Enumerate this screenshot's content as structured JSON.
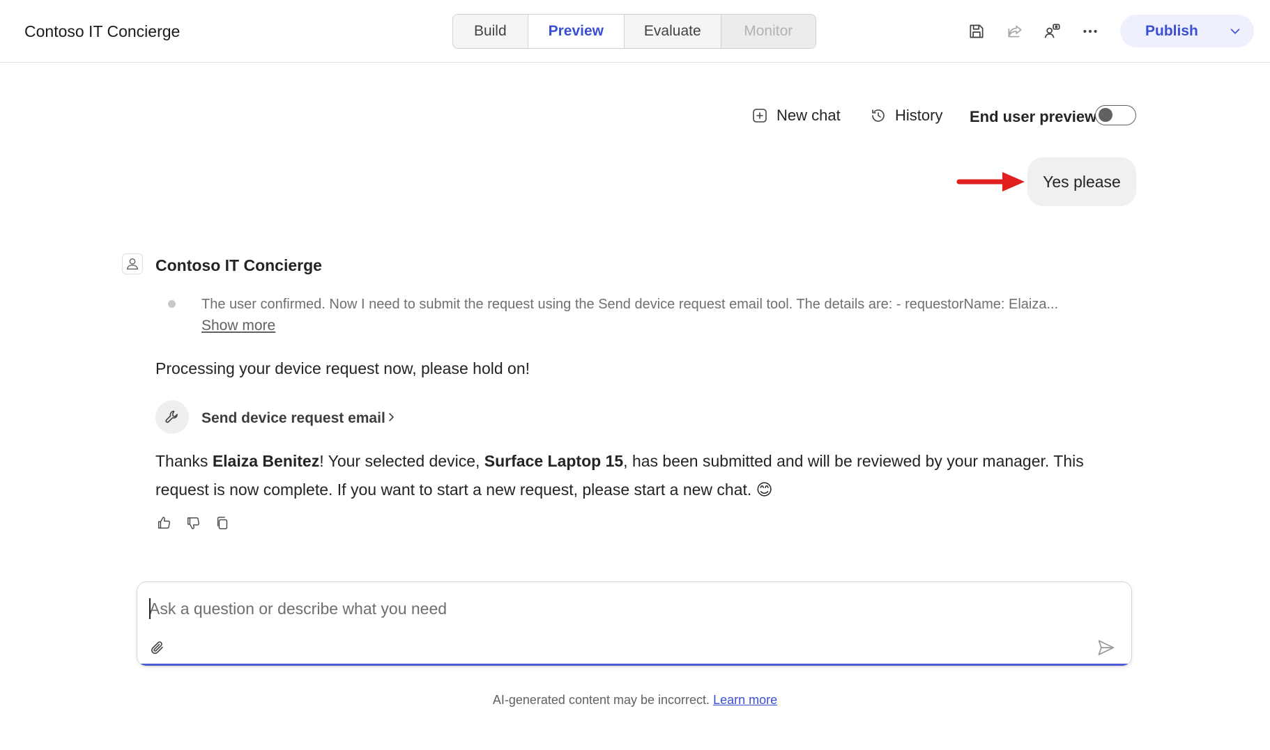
{
  "app": {
    "title": "Contoso IT Concierge"
  },
  "tabs": [
    {
      "label": "Build"
    },
    {
      "label": "Preview",
      "active": true
    },
    {
      "label": "Evaluate"
    },
    {
      "label": "Monitor",
      "disabled": true
    }
  ],
  "header_icons": [
    "save-icon",
    "share-icon",
    "users-settings-icon",
    "more-icon"
  ],
  "publish": {
    "label": "Publish"
  },
  "chat_toolbar": {
    "new_chat": "New chat",
    "history": "History",
    "end_user_preview": "End user preview",
    "end_user_preview_on": false
  },
  "user_message": {
    "text": "Yes please"
  },
  "bot": {
    "name": "Contoso IT Concierge",
    "reasoning": "The user confirmed. Now I need to submit the request using the Send device request email tool. The details are: - requestorName: Elaiza...",
    "show_more": "Show more",
    "processing": "Processing your device request now, please hold on!",
    "tool_name": "Send device request email",
    "response": {
      "part1": "Thanks ",
      "name": "Elaiza Benitez",
      "part2": "! Your selected device, ",
      "device": "Surface Laptop 15",
      "part3": ", has been submitted and will be reviewed by your manager. This request is now complete. If you want to start a new request, please start a new chat. 😊"
    }
  },
  "composer": {
    "placeholder": "Ask a question or describe what you need"
  },
  "disclaimer": {
    "text": "AI-generated content may be incorrect.",
    "link": "Learn more"
  },
  "colors": {
    "accent": "#3a4fd4",
    "annotation_arrow": "#e0201f",
    "user_bubble": "#f0f0f0"
  }
}
